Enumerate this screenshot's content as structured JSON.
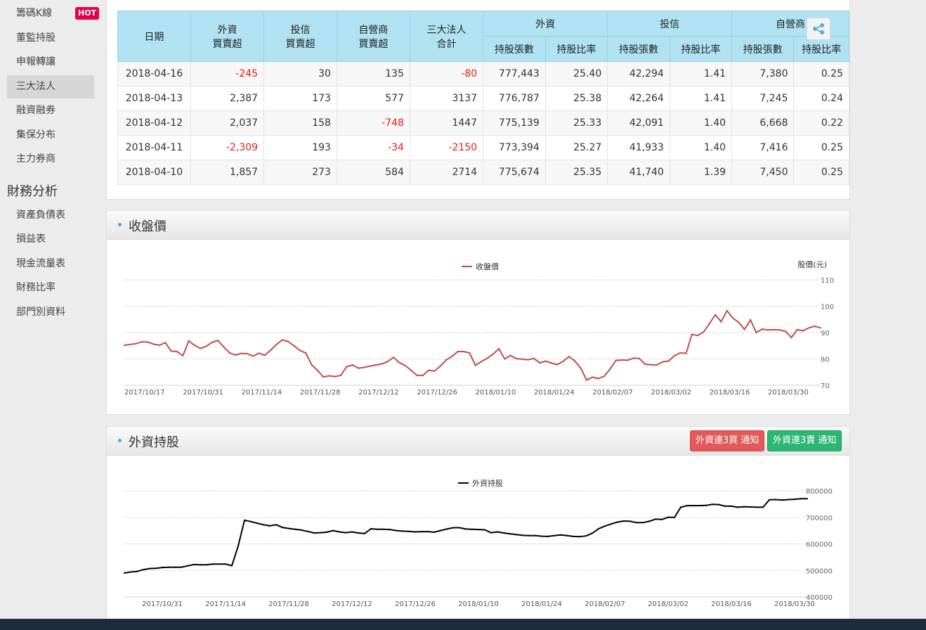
{
  "sidebar": {
    "items": [
      {
        "label": "籌碼K線",
        "top": 3
      },
      {
        "label": "董監持股",
        "top": 38
      },
      {
        "label": "申報轉讓",
        "top": 72
      },
      {
        "label": "三大法人",
        "top": 107
      },
      {
        "label": "融資融券",
        "top": 141
      },
      {
        "label": "集保分布",
        "top": 176
      },
      {
        "label": "主力券商",
        "top": 210
      },
      {
        "label": "資產負債表",
        "top": 290
      },
      {
        "label": "損益表",
        "top": 324
      },
      {
        "label": "現金流量表",
        "top": 359
      },
      {
        "label": "財務比率",
        "top": 393
      },
      {
        "label": "部門別資料",
        "top": 428
      }
    ],
    "hot_badge": "HOT",
    "section_title": "財務分析",
    "active_index": 3
  },
  "table": {
    "headers": {
      "date": "日期",
      "foreign": [
        "外資",
        "買賣超"
      ],
      "trust": [
        "投信",
        "買賣超"
      ],
      "dealer": [
        "自營商",
        "買賣超"
      ],
      "total": [
        "三大法人",
        "合計"
      ],
      "group_foreign": "外資",
      "group_trust": "投信",
      "group_dealer": "自營商",
      "sub_shares": "持股張數",
      "sub_ratio": "持股比率"
    },
    "rows": [
      [
        "2018-04-16",
        "-245",
        "30",
        "135",
        "-80",
        "777,443",
        "25.40",
        "42,294",
        "1.41",
        "7,380",
        "0.25"
      ],
      [
        "2018-04-13",
        "2,387",
        "173",
        "577",
        "3137",
        "776,787",
        "25.38",
        "42,264",
        "1.41",
        "7,245",
        "0.24"
      ],
      [
        "2018-04-12",
        "2,037",
        "158",
        "-748",
        "1447",
        "775,139",
        "25.33",
        "42,091",
        "1.40",
        "6,668",
        "0.22"
      ],
      [
        "2018-04-11",
        "-2,309",
        "193",
        "-34",
        "-2150",
        "773,394",
        "25.27",
        "41,933",
        "1.40",
        "7,416",
        "0.25"
      ],
      [
        "2018-04-10",
        "1,857",
        "273",
        "584",
        "2714",
        "775,674",
        "25.35",
        "41,740",
        "1.39",
        "7,450",
        "0.25"
      ]
    ]
  },
  "icons": {
    "share": "share-icon",
    "dot": "section-dot-icon"
  },
  "colors": {
    "header_bg": "#b0e2f1",
    "negative": "#e02020",
    "close_line": "#c0504d",
    "holding_line": "#000000",
    "buy_btn": "#e25a5a",
    "sell_btn": "#2bb673"
  },
  "close_panel": {
    "title": "收盤價"
  },
  "holding_panel": {
    "title": "外資持股",
    "btn_buy": "外資連3買 通知",
    "btn_sell": "外資連3賣 通知"
  },
  "chart_data": [
    {
      "type": "line",
      "legend": "收盤價",
      "ylabel": "股價(元)",
      "ylim": [
        70,
        110
      ],
      "yticks": [
        70,
        80,
        90,
        100,
        110
      ],
      "xticks": [
        "2017/10/17",
        "2017/10/31",
        "2017/11/14",
        "2017/11/28",
        "2017/12/12",
        "2017/12/26",
        "2018/01/10",
        "2018/01/24",
        "2018/02/07",
        "2018/03/02",
        "2018/03/16",
        "2018/03/30"
      ],
      "xtick_index": [
        0,
        10,
        20,
        30,
        40,
        50,
        60,
        70,
        80,
        90,
        100,
        110
      ],
      "values": [
        85.2,
        85.5,
        85.8,
        86.5,
        86.4,
        85.6,
        85.2,
        86.2,
        83.0,
        82.8,
        81.2,
        86.8,
        85.2,
        84.0,
        84.8,
        86.3,
        87.0,
        84.5,
        82.3,
        81.5,
        82.1,
        82.0,
        81.1,
        82.2,
        81.4,
        83.3,
        85.5,
        87.2,
        86.6,
        85.0,
        83.2,
        82.3,
        77.8,
        75.7,
        73.2,
        73.6,
        73.3,
        73.8,
        77.1,
        77.7,
        76.5,
        76.8,
        77.3,
        77.7,
        78.1,
        79.0,
        80.6,
        78.6,
        77.5,
        75.7,
        73.8,
        73.7,
        75.7,
        75.4,
        77.3,
        79.6,
        81.0,
        82.8,
        82.8,
        82.3,
        77.6,
        79.0,
        80.2,
        81.8,
        83.9,
        80.0,
        81.3,
        80.1,
        79.9,
        79.7,
        80.2,
        78.5,
        79.2,
        78.4,
        77.9,
        79.1,
        80.9,
        79.2,
        76.5,
        72.0,
        73.1,
        72.6,
        73.4,
        76.1,
        79.4,
        79.6,
        79.5,
        80.3,
        80.2,
        78.0,
        77.8,
        77.7,
        78.9,
        79.2,
        81.2,
        82.3,
        82.1,
        89.3,
        88.9,
        90.2,
        93.4,
        96.8,
        94.1,
        98.3,
        95.5,
        93.9,
        91.2,
        94.8,
        90.0,
        91.3,
        91.0,
        91.1,
        91.0,
        90.5,
        88.1,
        91.1,
        90.7,
        91.8,
        92.4,
        91.8
      ]
    },
    {
      "type": "line",
      "legend": "外資持股",
      "ylim": [
        400000,
        800000
      ],
      "yticks": [
        400000,
        500000,
        600000,
        700000,
        800000
      ],
      "xticks": [
        "2017/10/31",
        "2017/11/14",
        "2017/11/28",
        "2017/12/12",
        "2017/12/26",
        "2018/01/10",
        "2018/01/24",
        "2018/02/07",
        "2018/03/02",
        "2018/03/16",
        "2018/03/30"
      ],
      "xtick_index": [
        6,
        16,
        26,
        36,
        46,
        56,
        66,
        76,
        86,
        96,
        106
      ],
      "values": [
        490000,
        494000,
        496000,
        503000,
        507000,
        508000,
        511000,
        512000,
        512000,
        512000,
        517000,
        522000,
        521000,
        521000,
        524000,
        524000,
        524000,
        518000,
        592000,
        689000,
        684000,
        678000,
        672000,
        668000,
        672000,
        662000,
        658000,
        655000,
        652000,
        647000,
        641000,
        642000,
        644000,
        650000,
        645000,
        642000,
        645000,
        641000,
        639000,
        657000,
        655000,
        655000,
        654000,
        650000,
        648000,
        647000,
        645000,
        646000,
        646000,
        644000,
        650000,
        656000,
        661000,
        661000,
        656000,
        655000,
        654000,
        653000,
        642000,
        645000,
        641000,
        638000,
        635000,
        632000,
        631000,
        631000,
        629000,
        628000,
        631000,
        634000,
        631000,
        628000,
        627000,
        630000,
        640000,
        657000,
        667000,
        675000,
        682000,
        686000,
        685000,
        680000,
        680000,
        685000,
        693000,
        692000,
        700000,
        700000,
        738000,
        744000,
        744000,
        744000,
        745000,
        749000,
        748000,
        742000,
        742000,
        738000,
        740000,
        739000,
        738000,
        738000,
        766000,
        767000,
        765000,
        767000,
        768000,
        770000,
        770000
      ]
    }
  ]
}
